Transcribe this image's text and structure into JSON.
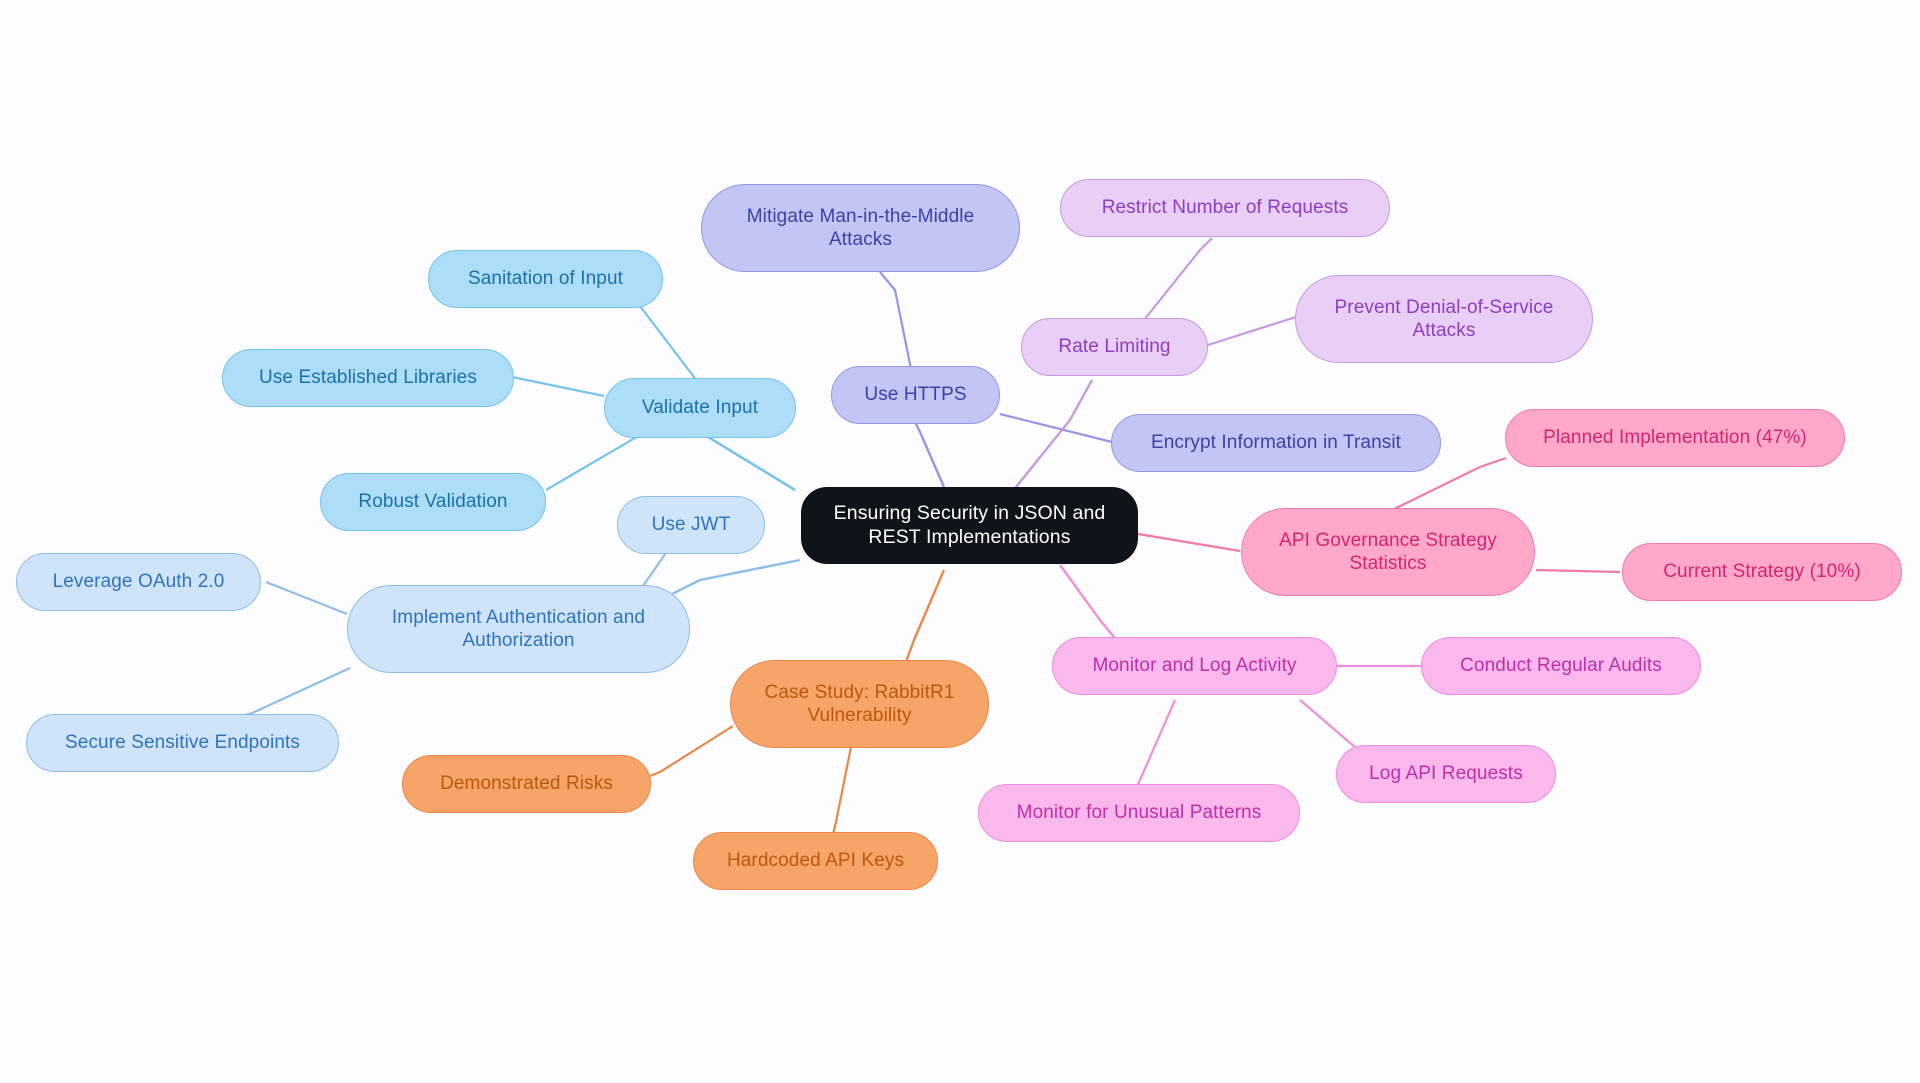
{
  "diagram": {
    "type": "mindmap",
    "title": "Ensuring Security in JSON and REST Implementations",
    "background": "#fdfdff"
  },
  "palette": {
    "root_fill": "#0e1419",
    "root_text": "#ffffff",
    "root_border": "#0e1419",
    "sky_fill": "#aeddf7",
    "sky_text": "#1b72ab",
    "sky_border": "#76c3ec",
    "blue_fill": "#cfe4f9",
    "blue_text": "#2e74c0",
    "blue_border": "#8fbde8",
    "indigo_fill": "#c3c6f5",
    "indigo_text": "#3e40a8",
    "indigo_border": "#9497e3",
    "violet_fill": "#e9cff5",
    "violet_text": "#8b3fc4",
    "violet_border": "#c79ae0",
    "pink_fill": "#ffa8cc",
    "pink_text": "#d6246e",
    "pink_border": "#f07ba8",
    "magenta_fill": "#fbb8ec",
    "magenta_text": "#c02fa8",
    "magenta_border": "#f08ddc",
    "orange_fill": "#f6a467",
    "orange_text": "#b85a12",
    "orange_border": "#e8884a"
  },
  "nodes": {
    "root": {
      "label": "Ensuring Security in JSON and\nREST Implementations"
    },
    "validate_input": {
      "label": "Validate Input"
    },
    "sanitation_of_input": {
      "label": "Sanitation of Input"
    },
    "use_established_libraries": {
      "label": "Use Established Libraries"
    },
    "robust_validation": {
      "label": "Robust Validation"
    },
    "use_https": {
      "label": "Use HTTPS"
    },
    "mitigate_mitm": {
      "label": "Mitigate Man-in-the-Middle\nAttacks"
    },
    "encrypt_in_transit": {
      "label": "Encrypt Information in Transit"
    },
    "rate_limiting": {
      "label": "Rate Limiting"
    },
    "restrict_requests": {
      "label": "Restrict Number of Requests"
    },
    "prevent_dos": {
      "label": "Prevent Denial-of-Service\nAttacks"
    },
    "implement_auth": {
      "label": "Implement Authentication and\nAuthorization"
    },
    "use_jwt": {
      "label": "Use JWT"
    },
    "leverage_oauth": {
      "label": "Leverage OAuth 2.0"
    },
    "secure_endpoints": {
      "label": "Secure Sensitive Endpoints"
    },
    "case_study": {
      "label": "Case Study: RabbitR1\nVulnerability"
    },
    "demonstrated_risks": {
      "label": "Demonstrated Risks"
    },
    "hardcoded_api_keys": {
      "label": "Hardcoded API Keys"
    },
    "monitor_log_activity": {
      "label": "Monitor and Log Activity"
    },
    "conduct_regular_audits": {
      "label": "Conduct Regular Audits"
    },
    "log_api_requests": {
      "label": "Log API Requests"
    },
    "monitor_unusual_patterns": {
      "label": "Monitor for Unusual Patterns"
    },
    "api_governance_stats": {
      "label": "API Governance Strategy\nStatistics"
    },
    "planned_implementation": {
      "label": "Planned Implementation (47%)"
    },
    "current_strategy": {
      "label": "Current Strategy (10%)"
    }
  }
}
